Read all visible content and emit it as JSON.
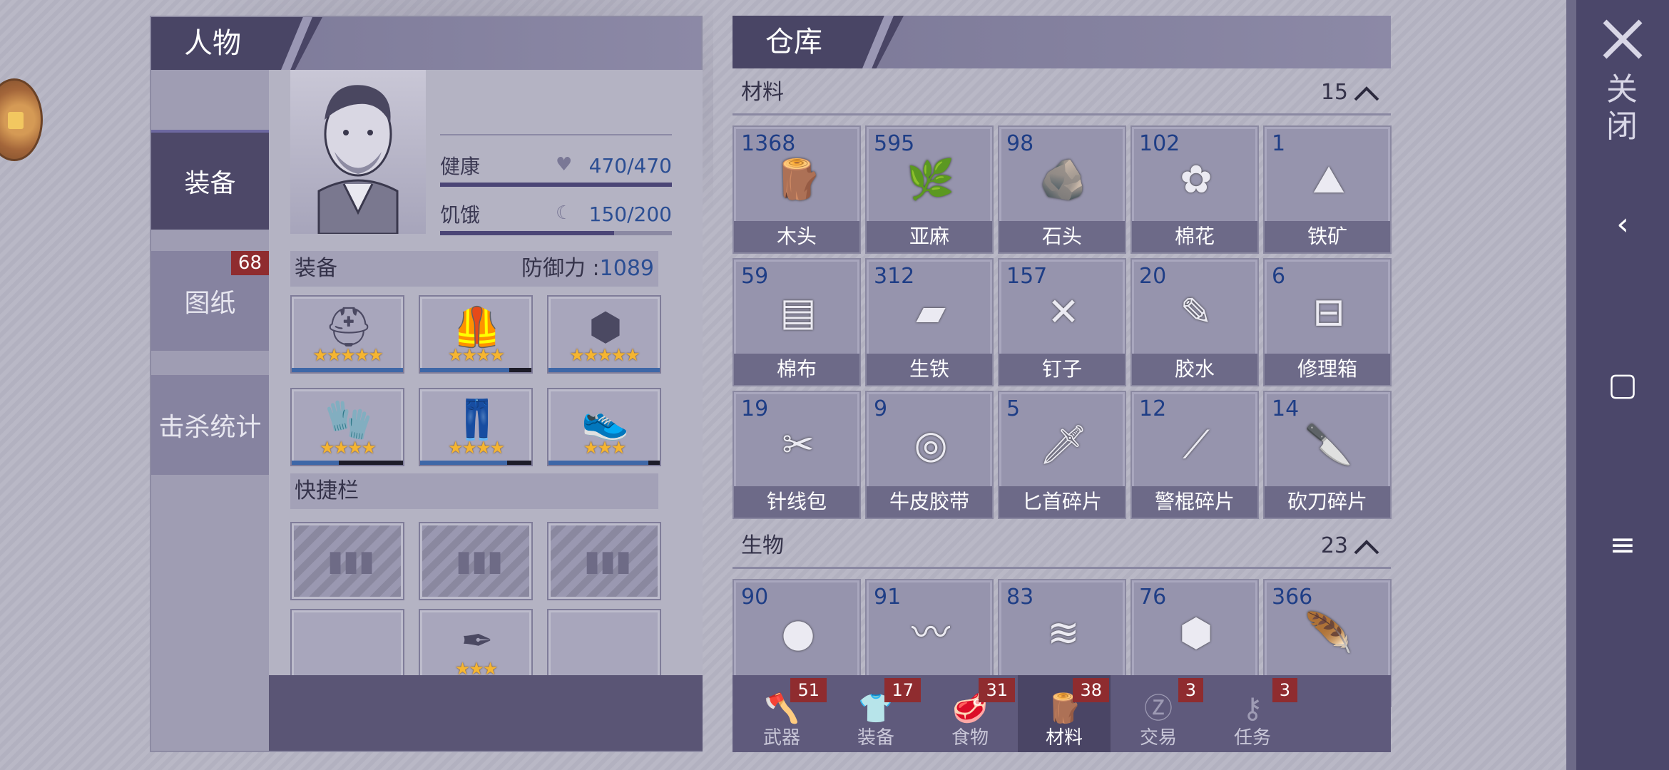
{
  "character_panel": {
    "title": "人物",
    "side_tabs": [
      {
        "label": "装备",
        "active": true
      },
      {
        "label": "图纸",
        "badge": "68"
      },
      {
        "label": "击杀统计"
      }
    ],
    "stats": {
      "health": {
        "label": "健康",
        "value": "470/470",
        "fraction": 1.0
      },
      "hunger": {
        "label": "饥饿",
        "value": "150/200",
        "fraction": 0.75
      }
    },
    "equipment": {
      "label": "装备",
      "defense_label": "防御力 :",
      "defense_value": "1089",
      "slots": [
        {
          "icon": "helmet-icon",
          "stars": "★★★★★",
          "durability": 1.0
        },
        {
          "icon": "armor-vest-icon",
          "stars": "★★★★",
          "durability": 0.8
        },
        {
          "icon": "turtle-shell-icon",
          "stars": "★★★★★",
          "durability": 1.0
        },
        {
          "icon": "gloves-icon",
          "stars": "★★★★",
          "durability": 0.42
        },
        {
          "icon": "pants-icon",
          "stars": "★★★★",
          "durability": 0.78
        },
        {
          "icon": "shoes-icon",
          "stars": "★★★",
          "durability": 0.9
        }
      ]
    },
    "quickbar": {
      "label": "快捷栏",
      "slots": [
        {
          "type": "locked"
        },
        {
          "type": "locked"
        },
        {
          "type": "locked"
        },
        {
          "type": "empty"
        },
        {
          "type": "item",
          "icon": "pen-weapon-icon",
          "stars": "★★★",
          "durability": 1.0
        },
        {
          "type": "empty"
        }
      ]
    }
  },
  "warehouse": {
    "title": "仓库",
    "categories": [
      {
        "label": "材料",
        "count": "15",
        "items": [
          {
            "qty": "1368",
            "name": "木头",
            "glyph": "🪵"
          },
          {
            "qty": "595",
            "name": "亚麻",
            "glyph": "🌿"
          },
          {
            "qty": "98",
            "name": "石头",
            "glyph": "🪨"
          },
          {
            "qty": "102",
            "name": "棉花",
            "glyph": "✿"
          },
          {
            "qty": "1",
            "name": "铁矿",
            "glyph": "⛰"
          },
          {
            "qty": "59",
            "name": "棉布",
            "glyph": "▤"
          },
          {
            "qty": "312",
            "name": "生铁",
            "glyph": "▰"
          },
          {
            "qty": "157",
            "name": "钉子",
            "glyph": "✕"
          },
          {
            "qty": "20",
            "name": "胶水",
            "glyph": "✎"
          },
          {
            "qty": "6",
            "name": "修理箱",
            "glyph": "⊟"
          },
          {
            "qty": "19",
            "name": "针线包",
            "glyph": "✂"
          },
          {
            "qty": "9",
            "name": "牛皮胶带",
            "glyph": "◎"
          },
          {
            "qty": "5",
            "name": "匕首碎片",
            "glyph": "🗡"
          },
          {
            "qty": "12",
            "name": "警棍碎片",
            "glyph": "⟋"
          },
          {
            "qty": "14",
            "name": "砍刀碎片",
            "glyph": "🔪"
          }
        ]
      },
      {
        "label": "生物",
        "count": "23",
        "items": [
          {
            "qty": "90",
            "glyph": "●"
          },
          {
            "qty": "91",
            "glyph": "〰"
          },
          {
            "qty": "83",
            "glyph": "≋"
          },
          {
            "qty": "76",
            "glyph": "⬢"
          },
          {
            "qty": "366",
            "glyph": "🪶"
          }
        ]
      }
    ],
    "bottom_tabs": [
      {
        "label": "武器",
        "badge": "51",
        "icon": "axe-icon",
        "glyph": "🪓"
      },
      {
        "label": "装备",
        "badge": "17",
        "icon": "shirt-icon",
        "glyph": "👕"
      },
      {
        "label": "食物",
        "badge": "31",
        "icon": "meat-icon",
        "glyph": "🥩"
      },
      {
        "label": "材料",
        "badge": "38",
        "icon": "wood-icon",
        "glyph": "🪵",
        "active": true
      },
      {
        "label": "交易",
        "badge": "3",
        "icon": "coin-icon",
        "glyph": "Ⓩ"
      },
      {
        "label": "任务",
        "badge": "3",
        "icon": "key-icon",
        "glyph": "⚷"
      }
    ]
  },
  "nav": {
    "close_label": "关闭"
  },
  "colors": {
    "badge": "#8f2c2f",
    "value_blue": "#2b4e93",
    "star": "#f5b531"
  }
}
